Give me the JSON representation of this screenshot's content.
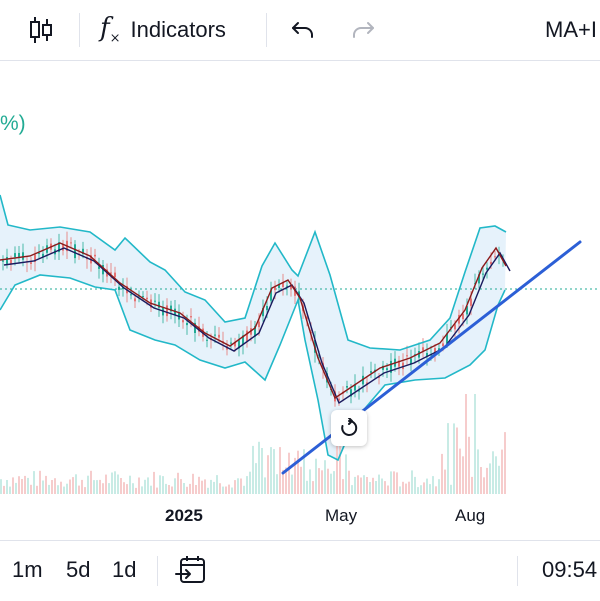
{
  "toolbar": {
    "chart_type_icon": "candlestick-icon",
    "indicators_icon": "fx-icon",
    "indicators_label": "Indicators",
    "undo_icon": "undo-icon",
    "redo_icon": "redo-icon",
    "indicator_overlay_label": "MA+I"
  },
  "legend": {
    "fragment": "%)"
  },
  "time_axis": {
    "labels": [
      "2025",
      "May",
      "Aug"
    ]
  },
  "reset_icon": "reset-view-icon",
  "bottom": {
    "ranges": [
      "1m",
      "5d",
      "1d"
    ],
    "date_range_icon": "calendar-goto-icon",
    "clock": "09:54"
  },
  "colors": {
    "bands": "#22b8c8",
    "band_fill": "#e3f1fb",
    "ma_dark": "#1a1a5e",
    "ma_red": "#8b1a1a",
    "trendline": "#2c5fd6",
    "up": "#22ab94",
    "down": "#e57373",
    "legend": "#22ab94"
  }
}
